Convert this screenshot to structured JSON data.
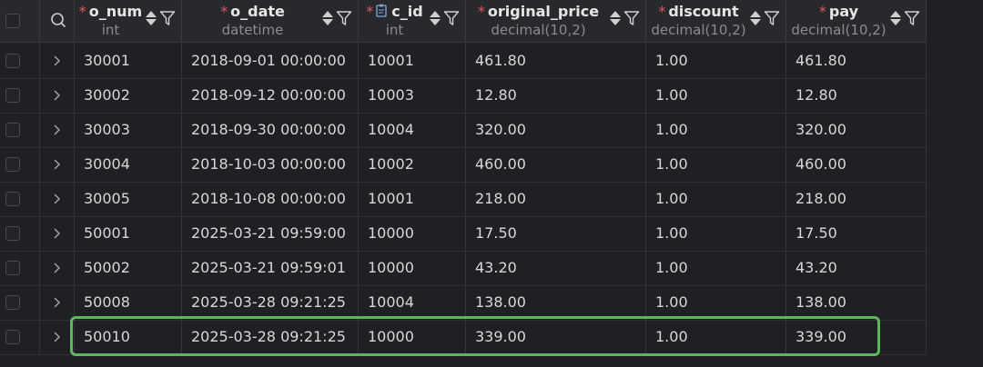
{
  "columns": [
    {
      "key": "o_num",
      "name": "o_num",
      "type": "int",
      "required": "*",
      "key_icon": false
    },
    {
      "key": "o_date",
      "name": "o_date",
      "type": "datetime",
      "required": "*",
      "key_icon": false
    },
    {
      "key": "c_id",
      "name": "c_id",
      "type": "int",
      "required": "*",
      "key_icon": true
    },
    {
      "key": "original_price",
      "name": "original_price",
      "type": "decimal(10,2)",
      "required": "*",
      "key_icon": false
    },
    {
      "key": "discount",
      "name": "discount",
      "type": "decimal(10,2)",
      "required": "*",
      "key_icon": false
    },
    {
      "key": "pay",
      "name": "pay",
      "type": "decimal(10,2)",
      "required": "*",
      "key_icon": false
    }
  ],
  "rows": [
    [
      "30001",
      "2018-09-01 00:00:00",
      "10001",
      "461.80",
      "1.00",
      "461.80"
    ],
    [
      "30002",
      "2018-09-12 00:00:00",
      "10003",
      "12.80",
      "1.00",
      "12.80"
    ],
    [
      "30003",
      "2018-09-30 00:00:00",
      "10004",
      "320.00",
      "1.00",
      "320.00"
    ],
    [
      "30004",
      "2018-10-03 00:00:00",
      "10002",
      "460.00",
      "1.00",
      "460.00"
    ],
    [
      "30005",
      "2018-10-08 00:00:00",
      "10001",
      "218.00",
      "1.00",
      "218.00"
    ],
    [
      "50001",
      "2025-03-21 09:59:00",
      "10000",
      "17.50",
      "1.00",
      "17.50"
    ],
    [
      "50002",
      "2025-03-21 09:59:01",
      "10000",
      "43.20",
      "1.00",
      "43.20"
    ],
    [
      "50008",
      "2025-03-28 09:21:25",
      "10004",
      "138.00",
      "1.00",
      "138.00"
    ],
    [
      "50010",
      "2025-03-28 09:21:25",
      "10000",
      "339.00",
      "1.00",
      "339.00"
    ]
  ],
  "highlighted_row": 8,
  "colors": {
    "background": "#1f2023",
    "header": "#28292d",
    "text": "#d8d8d8",
    "type_text": "#8b8c90",
    "required": "#e05a5a",
    "highlight": "#5cb85c"
  },
  "icons": {
    "search": "search-icon",
    "sort": "sort-icon",
    "filter": "filter-icon",
    "key": "document-key-icon",
    "expand": "chevron-right-icon",
    "checkbox": "checkbox-icon"
  }
}
